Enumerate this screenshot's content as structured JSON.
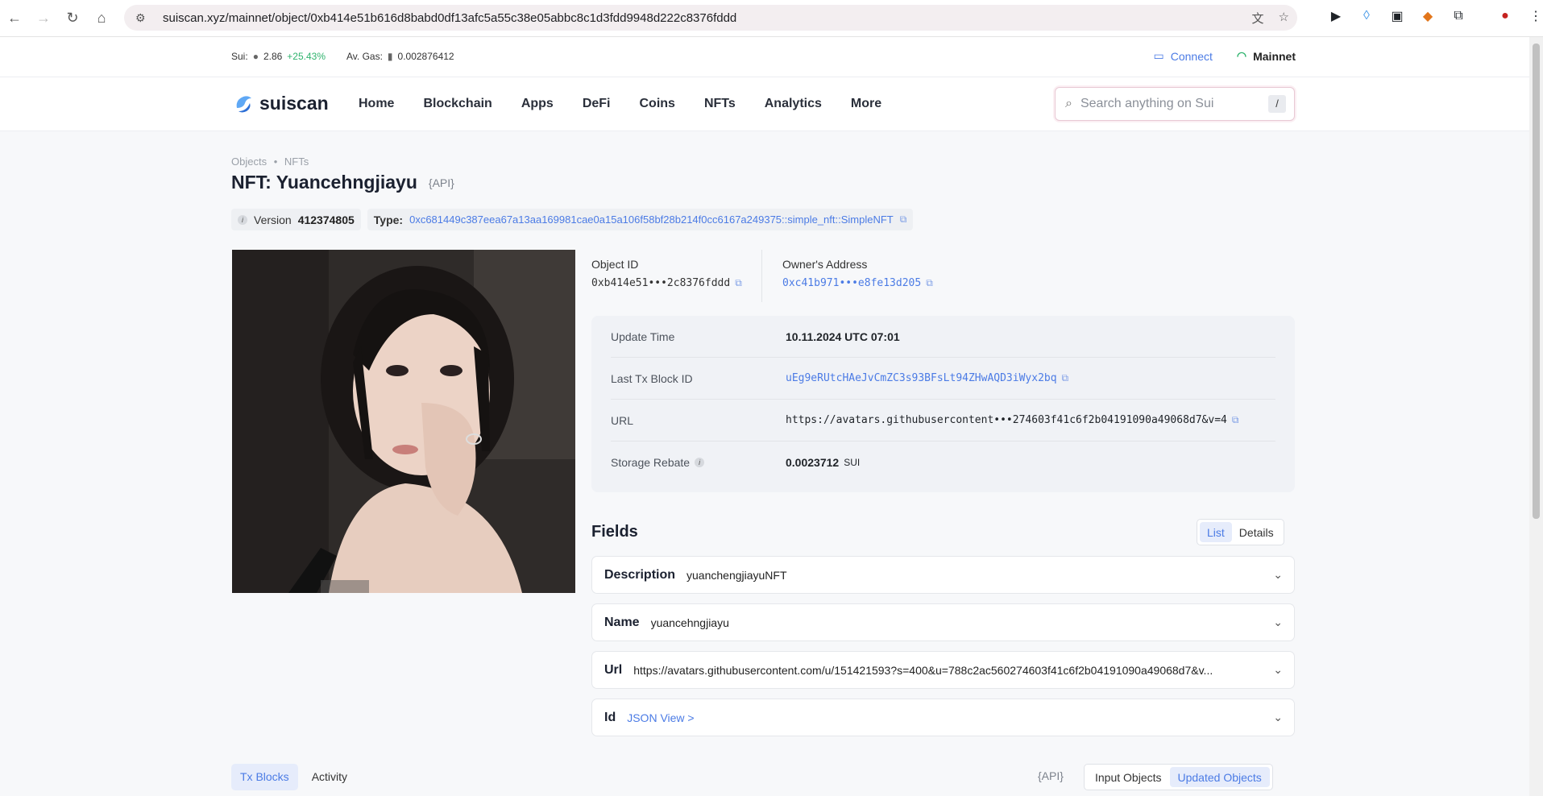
{
  "browser": {
    "url": "suiscan.xyz/mainnet/object/0xb414e51b616d8babd0df13afc5a55c38e05abbc8c1d3fdd9948d222c8376fddd"
  },
  "ticker": {
    "sui_label": "Sui:",
    "sui_price": "2.86",
    "sui_change": "+25.43%",
    "gas_label": "Av. Gas:",
    "gas_value": "0.002876412",
    "connect": "Connect",
    "network": "Mainnet"
  },
  "nav": {
    "logo": "suiscan",
    "items": [
      "Home",
      "Blockchain",
      "Apps",
      "DeFi",
      "Coins",
      "NFTs",
      "Analytics",
      "More"
    ],
    "search_placeholder": "Search anything on Sui",
    "search_key": "/"
  },
  "page": {
    "breadcrumb": [
      "Objects",
      "NFTs"
    ],
    "breadcrumb_sep": "•",
    "title": "NFT: Yuancehngjiayu",
    "api": "{API}",
    "version_label": "Version",
    "version": "412374805",
    "type_label": "Type:",
    "type_value": "0xc681449c387eea67a13aa169981cae0a15a106f58bf28b214f0cc6167a249375::simple_nft::SimpleNFT"
  },
  "ids": {
    "object_id_label": "Object ID",
    "object_id": "0xb414e51•••2c8376fddd",
    "owner_label": "Owner's Address",
    "owner": "0xc41b971•••e8fe13d205"
  },
  "details": [
    {
      "key": "Update Time",
      "value": "10.11.2024 UTC 07:01"
    },
    {
      "key": "Last Tx Block ID",
      "value": "uEg9eRUtcHAeJvCmZC3s93BFsLt94ZHwAQD3iWyx2bq"
    },
    {
      "key": "URL",
      "value": "https://avatars.githubusercontent•••274603f41c6f2b04191090a49068d7&v=4"
    },
    {
      "key": "Storage Rebate",
      "value": "0.0023712",
      "unit": "SUI"
    }
  ],
  "fields": {
    "heading": "Fields",
    "toggle": [
      "List",
      "Details"
    ],
    "items": [
      {
        "key": "Description",
        "value": "yuanchengjiayuNFT"
      },
      {
        "key": "Name",
        "value": "yuancehngjiayu"
      },
      {
        "key": "Url",
        "value": "https://avatars.githubusercontent.com/u/151421593?s=400&u=788c2ac560274603f41c6f2b04191090a49068d7&v..."
      },
      {
        "key": "Id",
        "value": "JSON View >"
      }
    ]
  },
  "bottom": {
    "tabs": [
      "Tx Blocks",
      "Activity"
    ],
    "api": "{API}",
    "toggle": [
      "Input Objects",
      "Updated Objects"
    ]
  },
  "colors": {
    "accent": "#4b7be5",
    "positive": "#2fb36d"
  }
}
